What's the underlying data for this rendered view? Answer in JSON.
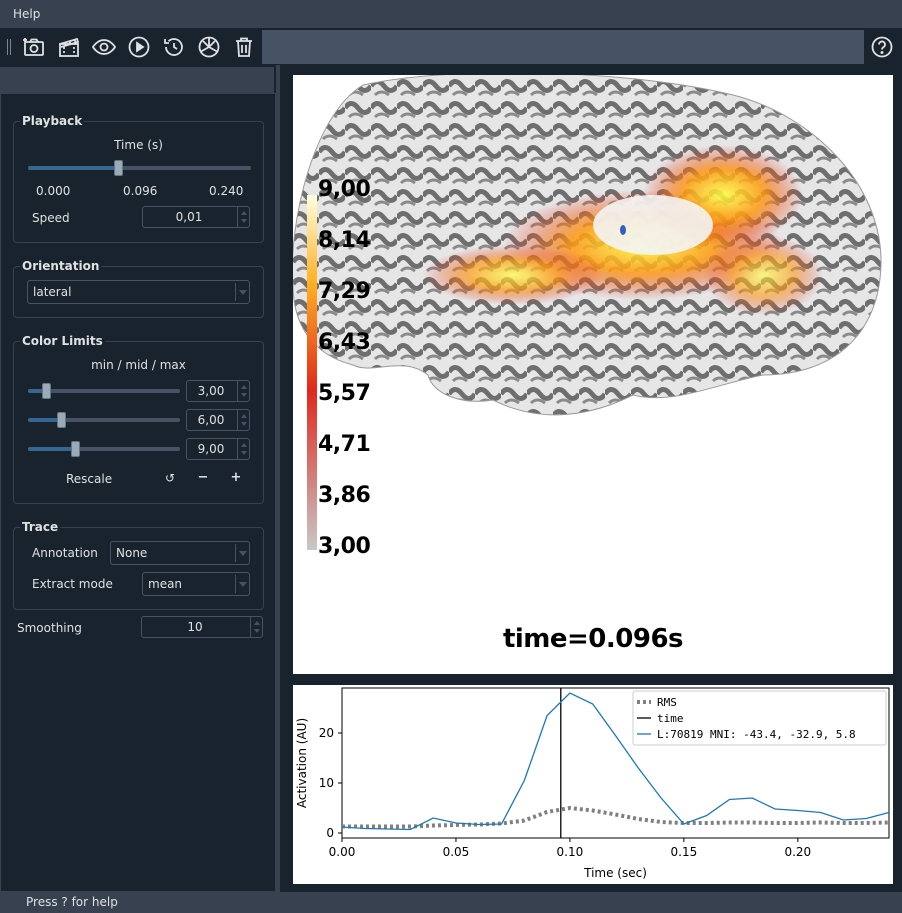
{
  "menubar": {
    "help_label": "Help"
  },
  "toolbar": {
    "buttons": [
      {
        "name": "screenshot-icon"
      },
      {
        "name": "movie-icon"
      },
      {
        "name": "visibility-icon"
      },
      {
        "name": "play-icon"
      },
      {
        "name": "reset-icon"
      },
      {
        "name": "restore-icon"
      },
      {
        "name": "clear-icon"
      }
    ],
    "help_icon": "help-icon"
  },
  "playback": {
    "title": "Playback",
    "time_label": "Time (s)",
    "time_min": "0.000",
    "time_current": "0.096",
    "time_max": "0.240",
    "time_fraction": 0.4,
    "speed_label": "Speed",
    "speed_value": "0,01"
  },
  "orientation": {
    "title": "Orientation",
    "value": "lateral"
  },
  "color_limits": {
    "title": "Color Limits",
    "header": "min / mid / max",
    "min_value": "3,00",
    "mid_value": "6,00",
    "max_value": "9,00",
    "min_fraction": 0.1,
    "mid_fraction": 0.2,
    "max_fraction": 0.3,
    "rescale_label": "Rescale",
    "reset_glyph": "↺",
    "minus_glyph": "−",
    "plus_glyph": "+"
  },
  "trace": {
    "title": "Trace",
    "annotation_label": "Annotation",
    "annotation_value": "None",
    "extract_label": "Extract mode",
    "extract_value": "mean"
  },
  "smoothing": {
    "label": "Smoothing",
    "value": "10"
  },
  "viewer": {
    "time_text": "time=0.096s",
    "colorbar_labels": [
      "9,00",
      "8,14",
      "7,29",
      "6,43",
      "5,57",
      "4,71",
      "3,86",
      "3,00"
    ],
    "colors": {
      "low": "#c8c8c8",
      "mid": "#e0281e",
      "high": "#ffff40"
    }
  },
  "status": {
    "text": "Press ? for help"
  },
  "chart_data": {
    "type": "line",
    "xlabel": "Time (sec)",
    "ylabel": "Activation (AU)",
    "xlim": [
      0.0,
      0.24
    ],
    "ylim": [
      -1,
      29
    ],
    "xticks": [
      "0.00",
      "0.05",
      "0.10",
      "0.15",
      "0.20"
    ],
    "xtick_values": [
      0.0,
      0.05,
      0.1,
      0.15,
      0.2
    ],
    "yticks": [
      "0",
      "10",
      "20"
    ],
    "ytick_values": [
      0,
      10,
      20
    ],
    "time_marker": 0.096,
    "legend_placement": "top-right",
    "series": [
      {
        "name": "RMS",
        "style": "dotted",
        "color": "#808080",
        "x": [
          0.0,
          0.01,
          0.02,
          0.03,
          0.04,
          0.05,
          0.06,
          0.07,
          0.08,
          0.09,
          0.1,
          0.11,
          0.12,
          0.13,
          0.14,
          0.15,
          0.16,
          0.17,
          0.18,
          0.19,
          0.2,
          0.21,
          0.22,
          0.23,
          0.24
        ],
        "y": [
          1.3,
          1.3,
          1.3,
          1.3,
          1.5,
          1.6,
          1.7,
          1.9,
          2.5,
          4.2,
          5.0,
          4.5,
          3.7,
          2.8,
          2.2,
          2.0,
          2.0,
          2.1,
          2.1,
          2.0,
          2.0,
          2.1,
          2.0,
          2.0,
          2.1
        ]
      },
      {
        "name": "time",
        "style": "solid",
        "color": "#000000"
      },
      {
        "name": "L:70819  MNI: -43.4, -32.9,   5.8",
        "style": "solid",
        "color": "#1f77b4",
        "x": [
          0.0,
          0.01,
          0.02,
          0.03,
          0.04,
          0.05,
          0.06,
          0.07,
          0.08,
          0.09,
          0.1,
          0.11,
          0.12,
          0.13,
          0.14,
          0.15,
          0.16,
          0.17,
          0.18,
          0.19,
          0.2,
          0.21,
          0.22,
          0.23,
          0.24
        ],
        "y": [
          1.2,
          0.9,
          0.8,
          0.7,
          3.0,
          2.0,
          1.7,
          1.8,
          10.5,
          23.5,
          28.0,
          25.8,
          19.5,
          13.0,
          7.0,
          1.8,
          3.5,
          6.7,
          7.0,
          4.8,
          4.5,
          4.1,
          2.6,
          2.9,
          4.1
        ]
      }
    ]
  }
}
